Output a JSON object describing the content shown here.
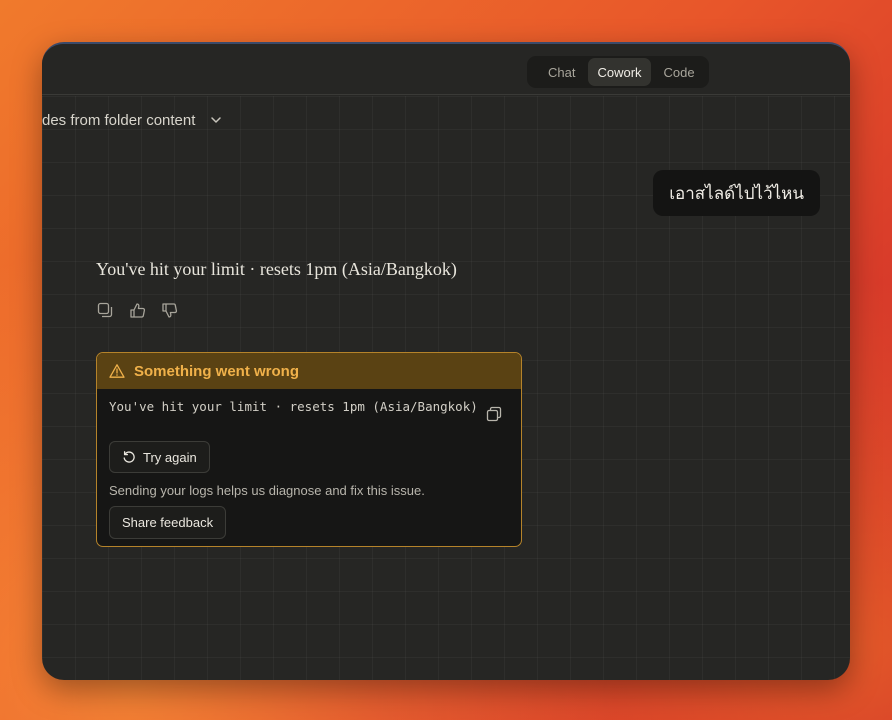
{
  "mode_switch": {
    "tabs": [
      "Chat",
      "Cowork",
      "Code"
    ],
    "active": "Cowork"
  },
  "conversation": {
    "title_fragment": "des from folder content"
  },
  "user_message": {
    "text": "เอาสไลด์ไปไว้ไหน"
  },
  "assistant_message": {
    "text": "You've hit your limit · resets 1pm (Asia/Bangkok)"
  },
  "message_actions": {
    "icons": [
      "copy-icon",
      "thumbs-up-icon",
      "thumbs-down-icon"
    ]
  },
  "error_card": {
    "title": "Something went wrong",
    "message": "You've hit your limit · resets 1pm (Asia/Bangkok)",
    "try_again_label": "Try again",
    "logs_note": "Sending your logs helps us diagnose and fix this issue.",
    "share_feedback_label": "Share feedback"
  },
  "colors": {
    "warning_accent": "#f0b14a",
    "warning_header_bg": "#5a4213",
    "warning_border": "#b5832a",
    "window_bg": "#262624"
  }
}
